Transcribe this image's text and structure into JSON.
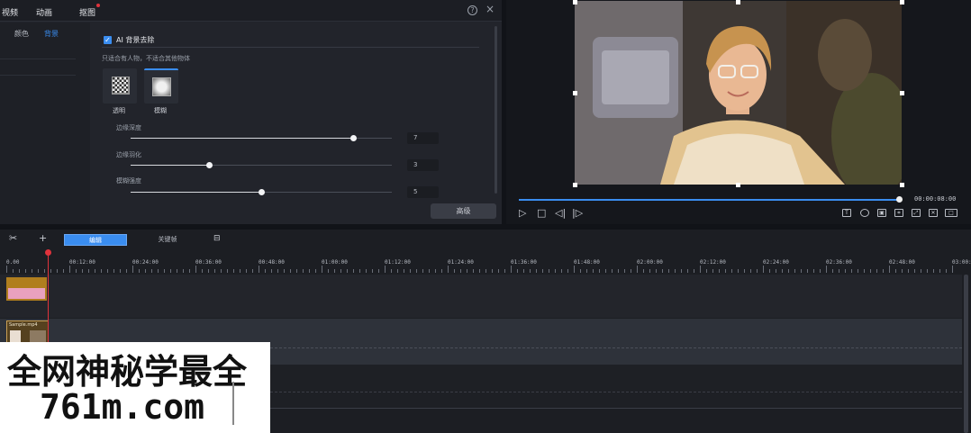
{
  "props_panel": {
    "tabs": [
      "视频",
      "动画",
      "抠图"
    ],
    "active_tab": 2,
    "sub_tabs": [
      "颜色",
      "背景"
    ],
    "active_sub_tab": 1,
    "ai_checkbox": {
      "label": "AI 背景去除",
      "checked": true
    },
    "hint": "只适合有人物，不适合其他物体",
    "modes": [
      "透明",
      "模糊"
    ],
    "selected_mode": 1,
    "sliders": [
      {
        "label": "边缘深度",
        "value": "7",
        "fraction": 0.85
      },
      {
        "label": "边缘羽化",
        "value": "3",
        "fraction": 0.3
      },
      {
        "label": "模糊强度",
        "value": "5",
        "fraction": 0.5
      }
    ],
    "advanced_button": "高级",
    "icons": {
      "help": "help-icon",
      "close": "close-icon"
    }
  },
  "preview": {
    "timecode": "00:00:08:00",
    "progress": 0.99,
    "controls": [
      "play-icon",
      "stop-icon",
      "prev-frame-icon",
      "next-frame-icon"
    ],
    "right_icons": [
      "text-icon",
      "snapshot-icon",
      "volume-icon",
      "crop-icon",
      "fullscreen-icon",
      "ratio-icon"
    ]
  },
  "timeline": {
    "tools": [
      "split-icon",
      "add-icon"
    ],
    "segments": [
      "编辑",
      "关键帧"
    ],
    "active_segment": 0,
    "ruler_labels": [
      "0.00",
      "00:12:00",
      "00:24:00",
      "00:36:00",
      "00:48:00",
      "01:00:00",
      "01:12:00",
      "01:24:00",
      "01:36:00",
      "01:48:00",
      "02:00:00",
      "02:12:00",
      "02:24:00",
      "02:36:00",
      "02:48:00",
      "03:00:00"
    ],
    "video_clip_label": "Sample.mp4",
    "accent": "#3a8df0",
    "playhead_color": "#e0333c"
  },
  "watermark": {
    "line1": "全网神秘学最全",
    "line2": "761m.com"
  }
}
